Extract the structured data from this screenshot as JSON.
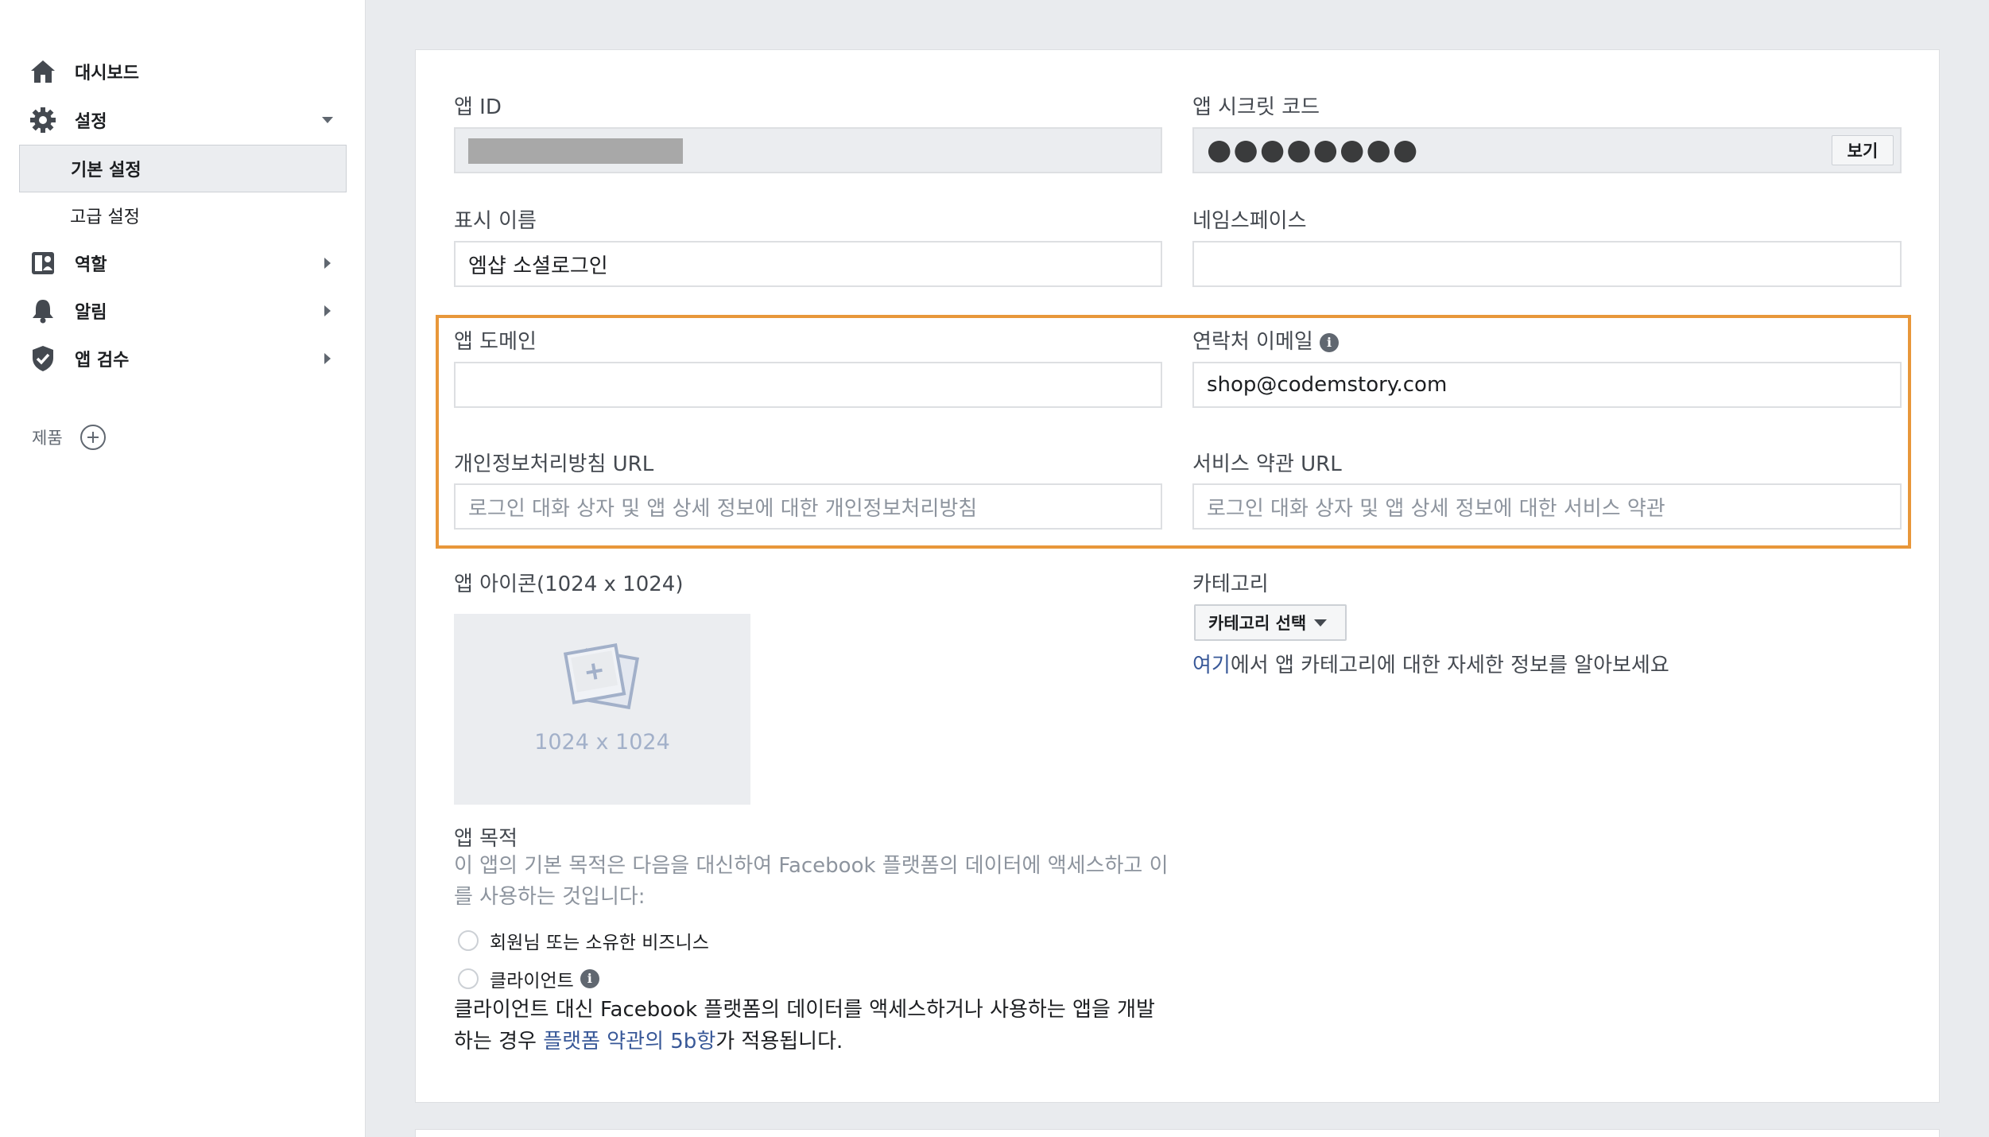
{
  "sidebar": {
    "dashboard": "대시보드",
    "settings": "설정",
    "basic_settings": "기본 설정",
    "advanced_settings": "고급 설정",
    "roles": "역할",
    "alerts": "알림",
    "app_review": "앱 검수",
    "products": "제품"
  },
  "form": {
    "app_id": {
      "label": "앱 ID",
      "value": ""
    },
    "app_secret": {
      "label": "앱 시크릿 코드",
      "value": "●●●●●●●●",
      "reveal_button": "보기"
    },
    "display_name": {
      "label": "표시 이름",
      "value": "엠샵 소셜로그인"
    },
    "namespace": {
      "label": "네임스페이스",
      "value": ""
    },
    "app_domain": {
      "label": "앱 도메인",
      "value": ""
    },
    "contact_email": {
      "label": "연락처 이메일",
      "value": "shop@codemstory.com"
    },
    "privacy_url": {
      "label": "개인정보처리방침 URL",
      "placeholder": "로그인 대화 상자 및 앱 상세 정보에 대한 개인정보처리방침"
    },
    "terms_url": {
      "label": "서비스 약관 URL",
      "placeholder": "로그인 대화 상자 및 앱 상세 정보에 대한 서비스 약관"
    },
    "app_icon": {
      "label": "앱 아이콘(1024 x 1024)",
      "drop_text": "1024 x 1024"
    },
    "category": {
      "label": "카테고리",
      "button": "카테고리 선택",
      "help_link": "여기",
      "help_text": "에서 앱 카테고리에 대한 자세한 정보를 알아보세요"
    },
    "app_purpose": {
      "label": "앱 목적",
      "desc": "이 앱의 기본 목적은 다음을 대신하여 Facebook 플랫폼의 데이터에 액세스하고 이를 사용하는 것입니다:",
      "option_1": "회원님 또는 소유한 비즈니스",
      "option_2": "클라이언트",
      "note_prefix": "클라이언트 대신 Facebook 플랫폼의 데이터를 액세스하거나 사용하는 앱을 개발하는 경우 ",
      "note_link": "플랫폼 약관의 5b항",
      "note_suffix": "가 적용됩니다."
    }
  },
  "colors": {
    "highlight_border": "#e8973a",
    "link": "#385898",
    "sidebar_bg": "#ffffff",
    "page_bg": "#e9ebee"
  }
}
